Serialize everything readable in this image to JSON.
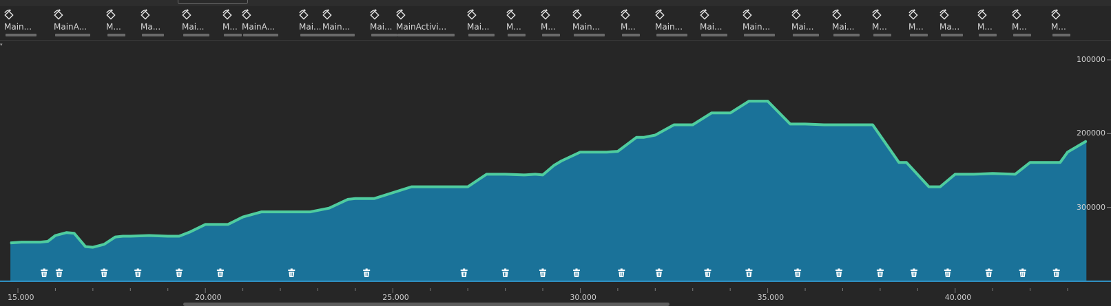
{
  "events": [
    {
      "label": "Main...",
      "icon": "rotation-icon"
    },
    {
      "label": "MainA...",
      "icon": "rotation-icon"
    },
    {
      "label": "M...",
      "icon": "rotation-icon"
    },
    {
      "label": "Ma...",
      "icon": "rotation-icon"
    },
    {
      "label": "Mai...",
      "icon": "rotation-icon"
    },
    {
      "label": "M...",
      "icon": "rotation-icon"
    },
    {
      "label": "MainA...",
      "icon": "rotation-icon"
    },
    {
      "label": "Mai...",
      "icon": "rotation-icon"
    },
    {
      "label": "Main...",
      "icon": "rotation-icon"
    },
    {
      "label": "Mai...",
      "icon": "rotation-icon"
    },
    {
      "label": "MainActivi...",
      "icon": "rotation-icon"
    },
    {
      "label": "Mai...",
      "icon": "rotation-icon"
    },
    {
      "label": "M...",
      "icon": "rotation-icon"
    },
    {
      "label": "M...",
      "icon": "rotation-icon"
    },
    {
      "label": "Main...",
      "icon": "rotation-icon"
    },
    {
      "label": "M...",
      "icon": "rotation-icon"
    },
    {
      "label": "Main...",
      "icon": "rotation-icon"
    },
    {
      "label": "Mai...",
      "icon": "rotation-icon"
    },
    {
      "label": "Main...",
      "icon": "rotation-icon"
    },
    {
      "label": "Mai...",
      "icon": "rotation-icon"
    },
    {
      "label": "Mai...",
      "icon": "rotation-icon"
    },
    {
      "label": "M...",
      "icon": "rotation-icon"
    },
    {
      "label": "M...",
      "icon": "rotation-icon"
    },
    {
      "label": "Ma...",
      "icon": "rotation-icon"
    },
    {
      "label": "M...",
      "icon": "rotation-icon"
    },
    {
      "label": "M...",
      "icon": "rotation-icon"
    },
    {
      "label": "M...",
      "icon": "rotation-icon"
    }
  ],
  "y_axis": {
    "labels": [
      "300000",
      "200000",
      "100000"
    ]
  },
  "x_axis": {
    "labels": [
      "15.000",
      "20.000",
      "25.000",
      "30.000",
      "35.000",
      "40.000"
    ]
  },
  "gc_icon": "trash-icon",
  "colors": {
    "background": "#262626",
    "area_fill": "#1a7299",
    "line": "#4fcc9f",
    "axis_line": "#2f8fc0"
  },
  "chart_data": {
    "type": "area",
    "xlim": [
      14.8,
      43.5
    ],
    "ylim": [
      0,
      335000
    ],
    "x": [
      14.8,
      15.1,
      15.6,
      15.8,
      16.0,
      16.3,
      16.5,
      16.8,
      17.0,
      17.3,
      17.6,
      17.8,
      18.0,
      18.5,
      19.0,
      19.3,
      19.6,
      20.0,
      20.3,
      20.6,
      21.0,
      21.5,
      22.0,
      22.3,
      22.5,
      22.8,
      23.3,
      23.8,
      24.0,
      24.5,
      25.5,
      26.0,
      26.5,
      26.8,
      27.0,
      27.5,
      28.0,
      28.5,
      28.8,
      29.0,
      29.3,
      29.5,
      30.0,
      30.4,
      30.7,
      31.0,
      31.5,
      31.7,
      32.0,
      32.5,
      32.8,
      33.0,
      33.5,
      33.7,
      34.0,
      34.5,
      34.8,
      35.0,
      35.6,
      36.0,
      36.5,
      37.0,
      37.6,
      37.8,
      38.5,
      38.7,
      39.3,
      39.6,
      40.0,
      40.5,
      41.0,
      41.6,
      42.0,
      42.5,
      42.8,
      43.0,
      43.5
    ],
    "y": [
      52000,
      53000,
      53000,
      54000,
      62000,
      66000,
      65000,
      47000,
      46000,
      50000,
      60000,
      61000,
      61000,
      62000,
      61000,
      61000,
      67000,
      77000,
      77000,
      77000,
      87000,
      94000,
      94000,
      94000,
      94000,
      94000,
      99000,
      111000,
      112000,
      112000,
      128000,
      128000,
      128000,
      128000,
      128000,
      145000,
      145000,
      144000,
      145000,
      144000,
      157000,
      163000,
      175000,
      175000,
      175000,
      176000,
      195000,
      195000,
      198000,
      212000,
      212000,
      212000,
      228000,
      228000,
      228000,
      244000,
      244000,
      244000,
      213000,
      213000,
      212000,
      212000,
      212000,
      212000,
      161000,
      161000,
      128000,
      128000,
      145000,
      145000,
      146000,
      145000,
      161000,
      161000,
      161000,
      175000,
      190000
    ],
    "yticks": [
      100000,
      200000,
      300000
    ],
    "xticks": [
      15,
      20,
      25,
      30,
      35,
      40
    ],
    "gc_events_x": [
      15.7,
      16.1,
      17.3,
      18.2,
      19.3,
      20.4,
      22.3,
      24.3,
      26.9,
      28.0,
      29.0,
      29.9,
      31.1,
      32.1,
      33.4,
      34.5,
      35.8,
      36.9,
      38.0,
      38.9,
      39.8,
      40.9,
      41.8,
      42.7
    ]
  }
}
